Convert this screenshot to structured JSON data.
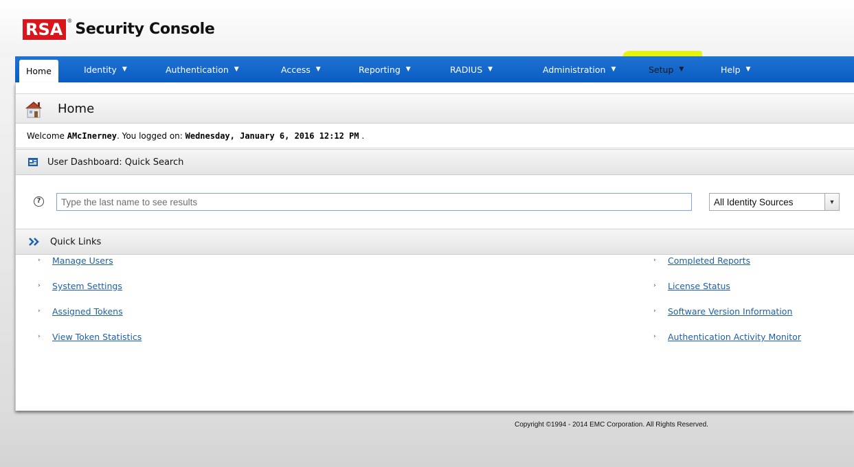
{
  "app": {
    "logo_text": "RSA",
    "registered_mark": "®",
    "title": "Security Console"
  },
  "nav": {
    "items": [
      {
        "label": "Home",
        "has_menu": false,
        "active": true
      },
      {
        "label": "Identity",
        "has_menu": true
      },
      {
        "label": "Authentication",
        "has_menu": true
      },
      {
        "label": "Access",
        "has_menu": true
      },
      {
        "label": "Reporting",
        "has_menu": true
      },
      {
        "label": "RADIUS",
        "has_menu": true
      },
      {
        "label": "Administration",
        "has_menu": true
      },
      {
        "label": "Setup",
        "has_menu": true,
        "highlighted": true
      },
      {
        "label": "Help",
        "has_menu": true
      }
    ],
    "caret": "▼",
    "highlight_color": "#e6f200"
  },
  "page": {
    "title": "Home",
    "icon": "home-icon"
  },
  "welcome": {
    "prefix": "Welcome ",
    "user": "AMcInerney",
    "middle": ". You logged on: ",
    "logon_time": "Wednesday, January 6, 2016 12:12 PM",
    "suffix": " ."
  },
  "dashboard": {
    "title": "User Dashboard: Quick Search",
    "icon": "dashboard-icon",
    "help_glyph": "?",
    "search_placeholder": "Type the last name to see results",
    "search_value": "",
    "source_selected": "All Identity Sources",
    "dropdown_arrow": "▼"
  },
  "quick_links": {
    "title": "Quick Links",
    "icon": "double-chevron-icon",
    "bullet": "›",
    "left": [
      "Manage Users",
      "System Settings",
      "Assigned Tokens",
      "View Token Statistics"
    ],
    "right": [
      "Completed Reports",
      "License Status",
      "Software Version Information",
      "Authentication Activity Monitor"
    ]
  },
  "footer": {
    "copyright": "Copyright ©1994 - 2014 EMC Corporation. All Rights Reserved."
  },
  "colors": {
    "brand_red": "#d8161b",
    "nav_blue": "#0a5cc2",
    "link_blue": "#1d5fa8"
  }
}
